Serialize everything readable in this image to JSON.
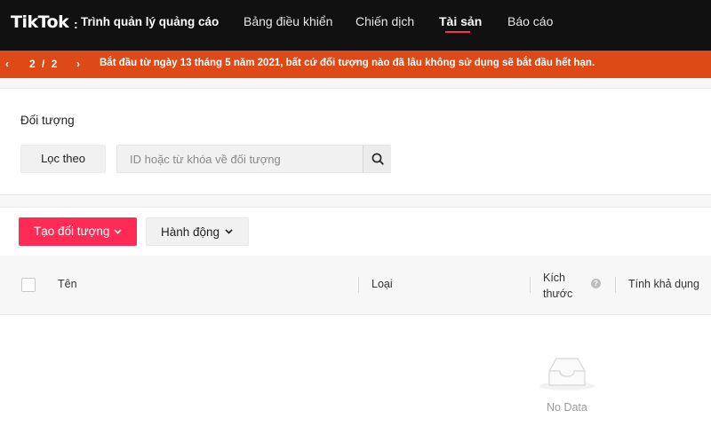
{
  "header": {
    "logo": "TikTok",
    "logo_sep": ":",
    "app_subtitle": "Trình quản lý quảng cáo",
    "nav": [
      {
        "label": "Bảng điều khiển"
      },
      {
        "label": "Chiến dịch"
      },
      {
        "label": "Tài sản",
        "active": true
      },
      {
        "label": "Báo cáo"
      }
    ]
  },
  "banner": {
    "prev": "‹",
    "page": "2 / 2",
    "next": "›",
    "message": "Bắt đầu từ ngày 13 tháng 5 năm 2021, bất cứ đối tượng nào đã lâu không sử dụng sẽ bắt đầu hết hạn.",
    "color": "#de4a17"
  },
  "filter": {
    "section_title": "Đối tượng",
    "filter_button": "Lọc theo",
    "search_placeholder": "ID hoặc từ khóa về đối tượng",
    "search_value": "",
    "search_icon": "search-icon"
  },
  "toolbar": {
    "create_label": "Tạo đối tượng",
    "action_label": "Hành động",
    "accent": "#fe2c55"
  },
  "table": {
    "columns": [
      {
        "label": "Tên"
      },
      {
        "label": "Loại"
      },
      {
        "label": "Kích\nthước"
      },
      {
        "label": "Tính khả dụng"
      }
    ],
    "help_icon": "?",
    "rows": []
  },
  "empty": {
    "text": "No Data",
    "icon": "inbox-icon"
  }
}
